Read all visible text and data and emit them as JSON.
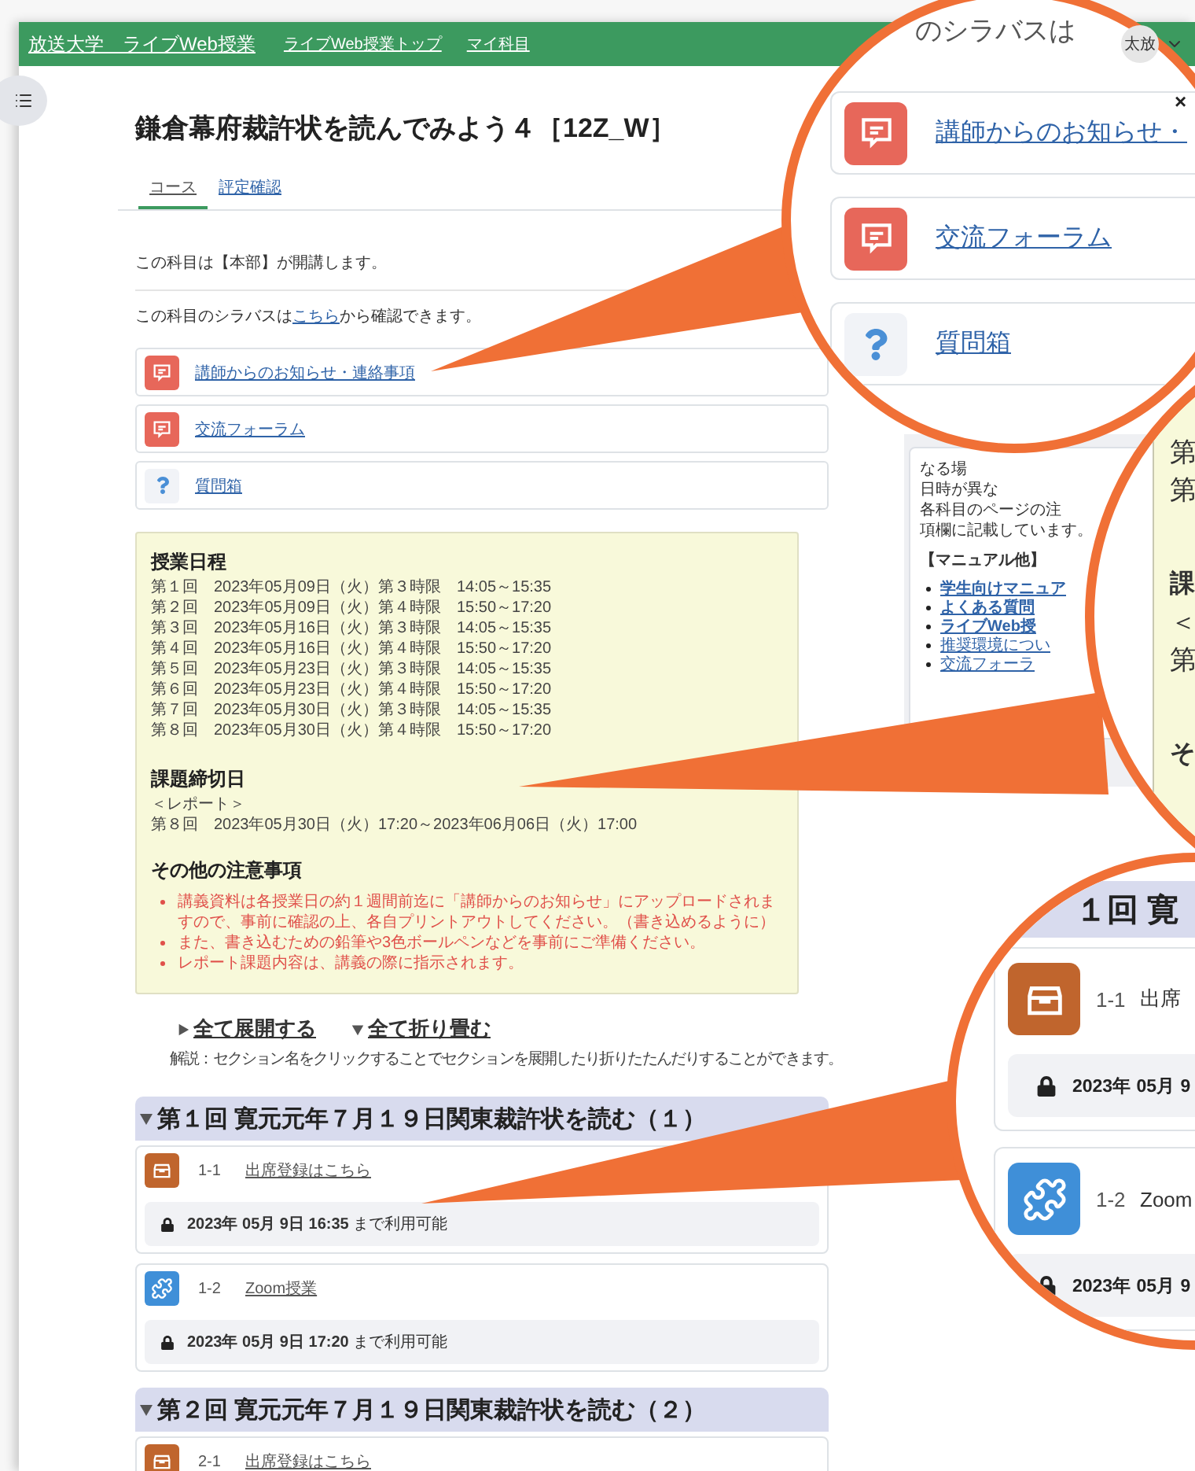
{
  "header": {
    "links": [
      "放送大学　ライブWeb授業",
      "ライブWeb授業トップ",
      "マイ科目"
    ],
    "avatar": "太放"
  },
  "course": {
    "title": "鎌倉幕府裁許状を読んでみよう４［12Z_W］",
    "tabs": [
      {
        "label": "コース",
        "selected": true
      },
      {
        "label": "評定確認",
        "selected": false
      }
    ]
  },
  "intro": {
    "host": "この科目は【本部】が開講します。",
    "syllabus_before": "この科目のシラバスは",
    "syllabus_link": "こちら",
    "syllabus_after": "から確認できます。"
  },
  "activities": [
    {
      "kind": "forum",
      "title": "講師からのお知らせ・連絡事項"
    },
    {
      "kind": "forum",
      "title": "交流フォーラム"
    },
    {
      "kind": "question",
      "title": "質問箱"
    }
  ],
  "schedule": {
    "heading": "授業日程",
    "rows": [
      "第１回　2023年05月09日（火）第３時限　14:05～15:35",
      "第２回　2023年05月09日（火）第４時限　15:50～17:20",
      "第３回　2023年05月16日（火）第３時限　14:05～15:35",
      "第４回　2023年05月16日（火）第４時限　15:50～17:20",
      "第５回　2023年05月23日（火）第３時限　14:05～15:35",
      "第６回　2023年05月23日（火）第４時限　15:50～17:20",
      "第７回　2023年05月30日（火）第３時限　14:05～15:35",
      "第８回　2023年05月30日（火）第４時限　15:50～17:20"
    ],
    "deadline_heading": "課題締切日",
    "deadline_lines": [
      "＜レポート＞",
      "第８回　2023年05月30日（火）17:20～2023年06月06日（火）17:00"
    ],
    "notes_heading": "その他の注意事項",
    "notes": [
      "講義資料は各授業日の約１週間前迄に「講師からのお知らせ」にアップロードされますので、事前に確認の上、各自プリントアウトしてください。（書き込めるように）",
      "また、書き込むための鉛筆や3色ボールペンなどを事前にご準備ください。",
      "レポート課題内容は、講義の際に指示されます。"
    ]
  },
  "section_controls": {
    "expand": "全て展開する",
    "collapse": "全て折り畳む",
    "hint": "解説：セクション名をクリックすることでセクションを展開したり折りたたんだりすることができます。"
  },
  "sections": [
    {
      "title": "第１回 寛元元年７月１９日関東裁許状を読む（１）",
      "expanded": true,
      "items": [
        {
          "kind": "attendance",
          "number": "1-1",
          "title": "出席登録はこちら",
          "restriction": "**2023年 05月 9日 16:35** まで利用可能"
        },
        {
          "kind": "zoom",
          "number": "1-2",
          "title": "Zoom授業",
          "restriction": "**2023年 05月 9日 17:20** まで利用可能"
        }
      ]
    },
    {
      "title": "第２回 寛元元年７月１９日関東裁許状を読む（２）",
      "expanded": true,
      "items": [
        {
          "kind": "attendance",
          "number": "2-1",
          "title": "出席登録はこちら"
        }
      ]
    }
  ],
  "sidebar": {
    "lines": [
      "なる場",
      "日時が異な",
      "各科目のページの注",
      "項欄に記載しています。"
    ],
    "manual_heading": "【マニュアル他】",
    "links": [
      {
        "label": "学生向けマニュア",
        "bold": true
      },
      {
        "label": "よくある質問",
        "bold": true
      },
      {
        "label": "ライブWeb授",
        "bold": true
      },
      {
        "label": "推奨環境につい",
        "bold": false
      },
      {
        "label": "交流フォーラ",
        "bold": false
      }
    ]
  },
  "callouts": {
    "activities": {
      "top_text": "のシラバスは",
      "close": "×",
      "cards": [
        {
          "kind": "forum",
          "title": "講師からのお知らせ・"
        },
        {
          "kind": "forum",
          "title": "交流フォーラム"
        },
        {
          "kind": "question",
          "title": "質問箱"
        }
      ]
    },
    "schedule": {
      "lines": [
        {
          "kind": "text",
          "text": "第"
        },
        {
          "kind": "text",
          "text": "第"
        },
        {
          "kind": "heading",
          "text": "課"
        },
        {
          "kind": "text",
          "text": "＜"
        },
        {
          "kind": "text",
          "text": "第"
        },
        {
          "kind": "heading",
          "text": "そ"
        }
      ]
    },
    "section": {
      "heading": "１回 寛",
      "items": [
        {
          "kind": "attendance",
          "number": "1-1",
          "title": "出席",
          "restriction": "2023年 05月 9"
        },
        {
          "kind": "zoom",
          "number": "1-2",
          "title": "Zoom",
          "restriction": "2023年 05月 9"
        }
      ]
    }
  }
}
